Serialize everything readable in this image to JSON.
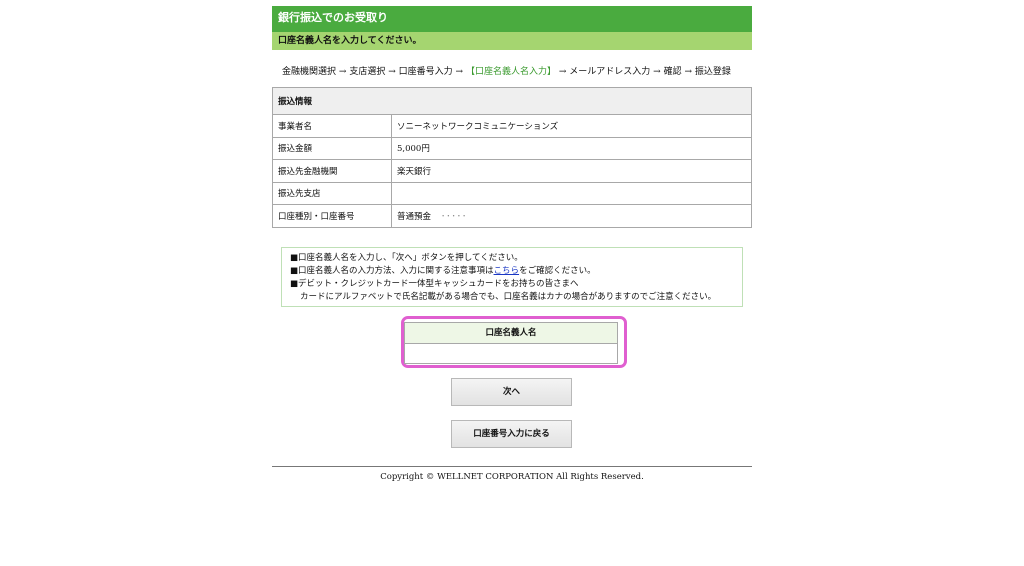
{
  "header": {
    "title": "銀行振込でのお受取り",
    "subtitle": "口座名義人名を入力してください。"
  },
  "steps": {
    "s1": "金融機関選択",
    "s2": "支店選択",
    "s3": "口座番号入力",
    "current": "【口座名義人名入力】",
    "s5": "メールアドレス入力",
    "s6": "確認",
    "s7": "振込登録",
    "arrow": "→"
  },
  "transfer_info": {
    "heading": "振込情報",
    "rows": [
      {
        "label": "事業者名",
        "value": "ソニーネットワークコミュニケーションズ"
      },
      {
        "label": "振込金額",
        "value": "5,000円"
      },
      {
        "label": "振込先金融機関",
        "value": "楽天銀行"
      },
      {
        "label": "振込先支店",
        "value": ""
      },
      {
        "label": "口座種別・口座番号",
        "value": "普通預金",
        "masked": "･････"
      }
    ]
  },
  "notes": {
    "line1": "■口座名義人名を入力し、「次へ」ボタンを押してください。",
    "line2_pre": "■口座名義人名の入力方法、入力に関する注意事項は",
    "line2_link": "こちら",
    "line2_post": "をご確認ください。",
    "line3": "■デビット・クレジットカード一体型キャッシュカードをお持ちの皆さまへ",
    "line4": "カードにアルファベットで氏名記載がある場合でも、口座名義はカナの場合がありますのでご注意ください。"
  },
  "name_field": {
    "label": "口座名義人名",
    "value": "",
    "placeholder": ""
  },
  "buttons": {
    "next": "次へ",
    "back": "口座番号入力に戻る"
  },
  "footer": {
    "copyright": "Copyright © WELLNET CORPORATION All Rights Reserved."
  },
  "colors": {
    "header_green": "#4aab3f",
    "subheader_green": "#a5d570",
    "current_step": "#3a9a2e",
    "highlight_magenta": "#e05fd0",
    "link_blue": "#1a37c4"
  }
}
